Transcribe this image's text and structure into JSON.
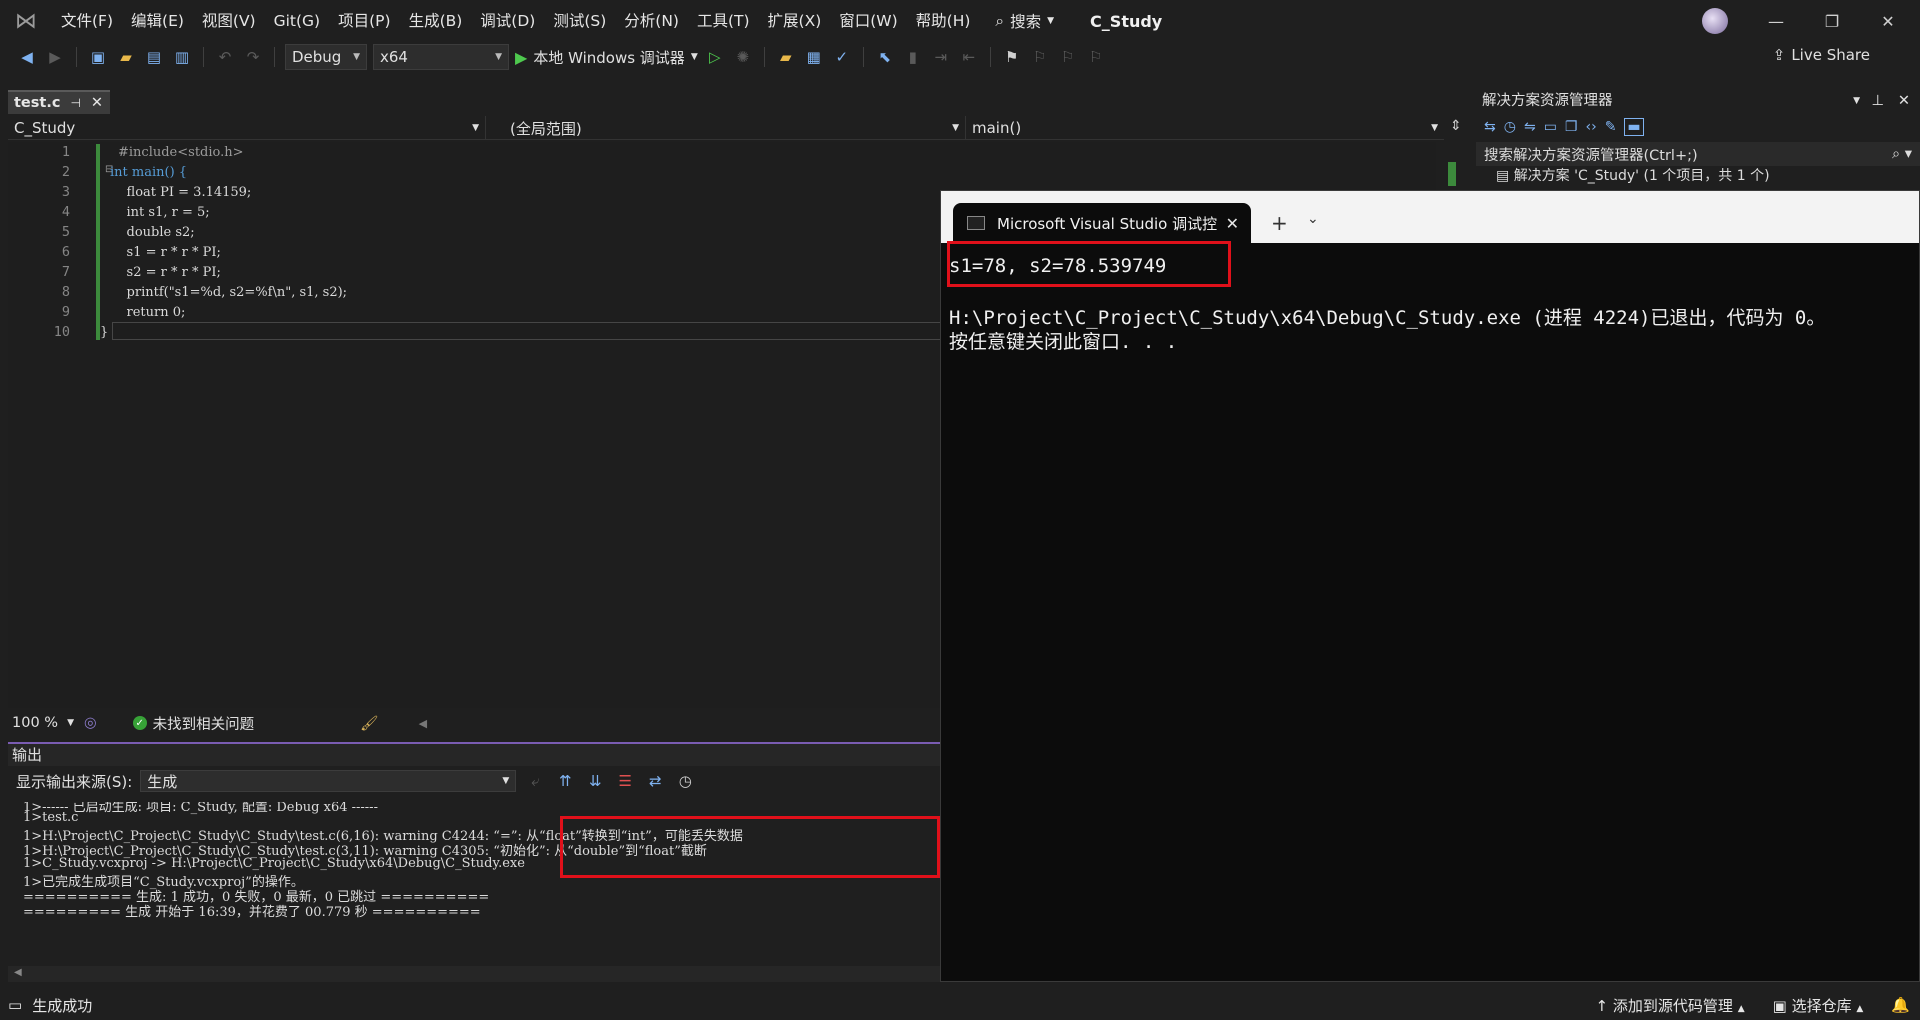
{
  "window": {
    "title": "C_Study",
    "menu": [
      "文件(F)",
      "编辑(E)",
      "视图(V)",
      "Git(G)",
      "项目(P)",
      "生成(B)",
      "调试(D)",
      "测试(S)",
      "分析(N)",
      "工具(T)",
      "扩展(X)",
      "窗口(W)",
      "帮助(H)"
    ],
    "search_label": "搜索"
  },
  "toolbar": {
    "configuration": "Debug",
    "platform": "x64",
    "run_label": "本地 Windows 调试器",
    "live_share": "Live Share"
  },
  "editor": {
    "tab_name": "test.c",
    "nav_project": "C_Study",
    "nav_scope": "(全局范围)",
    "nav_member": "main()",
    "lines": [
      {
        "num": "1",
        "text": "#include<stdio.h>"
      },
      {
        "num": "2",
        "text": "int main() {"
      },
      {
        "num": "3",
        "text": "    float PI = 3.14159;"
      },
      {
        "num": "4",
        "text": "    int s1, r = 5;"
      },
      {
        "num": "5",
        "text": "    double s2;"
      },
      {
        "num": "6",
        "text": "    s1 = r * r * PI;"
      },
      {
        "num": "7",
        "text": "    s2 = r * r * PI;"
      },
      {
        "num": "8",
        "text": "    printf(\"s1=%d, s2=%f\\n\", s1, s2);"
      },
      {
        "num": "9",
        "text": "    return 0;"
      },
      {
        "num": "10",
        "text": "}"
      }
    ],
    "zoom": "100 %",
    "issues": "未找到相关问题"
  },
  "output": {
    "title": "输出",
    "source_label": "显示输出来源(S):",
    "source_value": "生成",
    "lines": [
      "1>------ 已启动生成: 项目: C_Study, 配置: Debug x64 ------",
      "1>test.c",
      "1>H:\\Project\\C_Project\\C_Study\\C_Study\\test.c(6,16): warning C4244: “=”: 从“float”转换到“int”，可能丢失数据",
      "1>H:\\Project\\C_Project\\C_Study\\C_Study\\test.c(3,11): warning C4305: “初始化”: 从“double”到“float”截断",
      "1>C_Study.vcxproj -> H:\\Project\\C_Project\\C_Study\\x64\\Debug\\C_Study.exe",
      "1>已完成生成项目“C_Study.vcxproj”的操作。",
      "========== 生成: 1 成功，0 失败，0 最新，0 已跳过 ==========",
      "========= 生成 开始于 16:39，并花费了 00.779 秒 =========="
    ]
  },
  "solution_explorer": {
    "title": "解决方案资源管理器",
    "search_placeholder": "搜索解决方案资源管理器(Ctrl+;)",
    "root_item": "解决方案 'C_Study' (1 个项目，共 1 个)"
  },
  "console": {
    "tab_title": "Microsoft Visual Studio 调试控",
    "result_line": "s1=78, s2=78.539749",
    "exit_line": "H:\\Project\\C_Project\\C_Study\\x64\\Debug\\C_Study.exe (进程 4224)已退出，代码为 0。",
    "press_key_line": "按任意键关闭此窗口. . ."
  },
  "statusbar": {
    "build_status": "生成成功",
    "source_control": "添加到源代码管理",
    "repo": "选择仓库"
  },
  "colors": {
    "accent": "#7a5cb2",
    "highlight": "#e0101a",
    "change_bar": "#3c8a3c"
  }
}
